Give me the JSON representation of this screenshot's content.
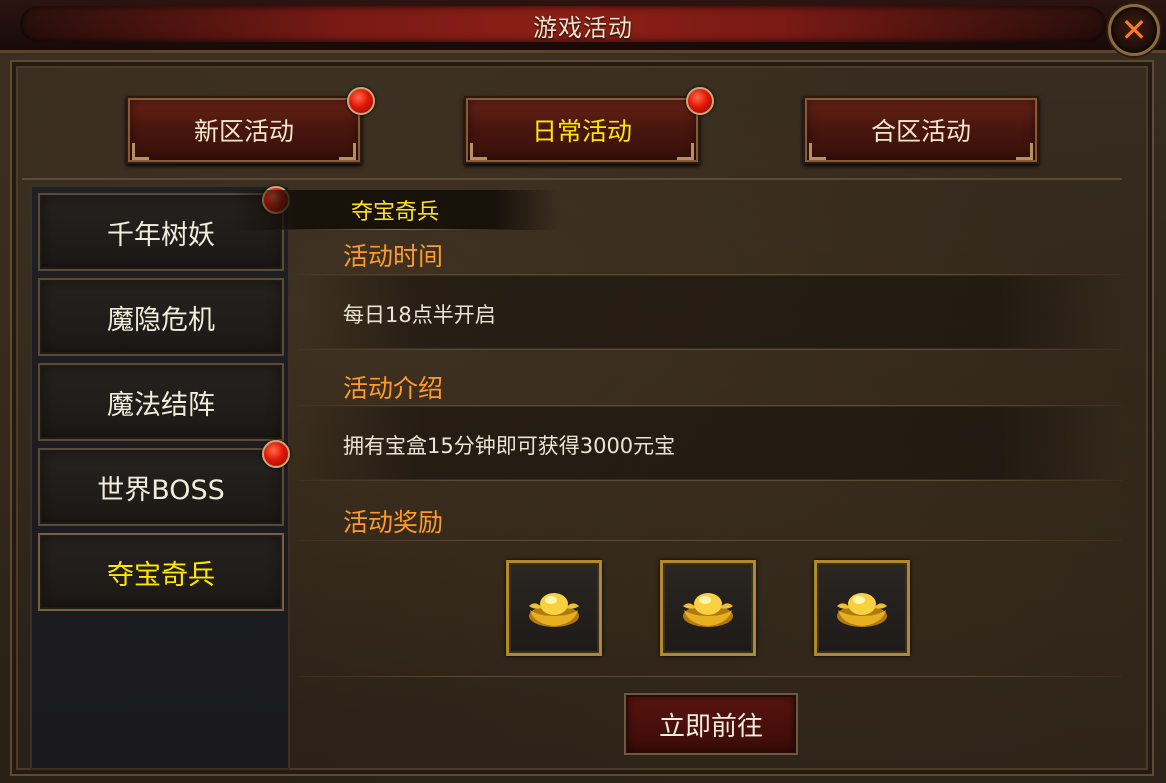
{
  "window": {
    "title": "游戏活动"
  },
  "tabs": [
    {
      "label": "新区活动",
      "active": false,
      "badge": true
    },
    {
      "label": "日常活动",
      "active": true,
      "badge": true
    },
    {
      "label": "合区活动",
      "active": false,
      "badge": false
    }
  ],
  "sidebar": {
    "items": [
      {
        "label": "千年树妖",
        "active": false,
        "badge": true
      },
      {
        "label": "魔隐危机",
        "active": false,
        "badge": false
      },
      {
        "label": "魔法结阵",
        "active": false,
        "badge": false
      },
      {
        "label": "世界BOSS",
        "active": false,
        "badge": true
      },
      {
        "label": "夺宝奇兵",
        "active": true,
        "badge": false
      }
    ]
  },
  "detail": {
    "title": "夺宝奇兵",
    "time_heading": "活动时间",
    "time_text": "每日18点半开启",
    "intro_heading": "活动介绍",
    "intro_text": "拥有宝盒15分钟即可获得3000元宝",
    "reward_heading": "活动奖励",
    "rewards": [
      {
        "icon": "gold-ingot-icon"
      },
      {
        "icon": "gold-ingot-icon"
      },
      {
        "icon": "gold-ingot-icon"
      }
    ],
    "go_button": "立即前往"
  },
  "colors": {
    "accent_yellow": "#ffe600",
    "heading_orange": "#ff9a2a",
    "badge_red": "#e01808",
    "close_orange": "#ff7a20"
  }
}
